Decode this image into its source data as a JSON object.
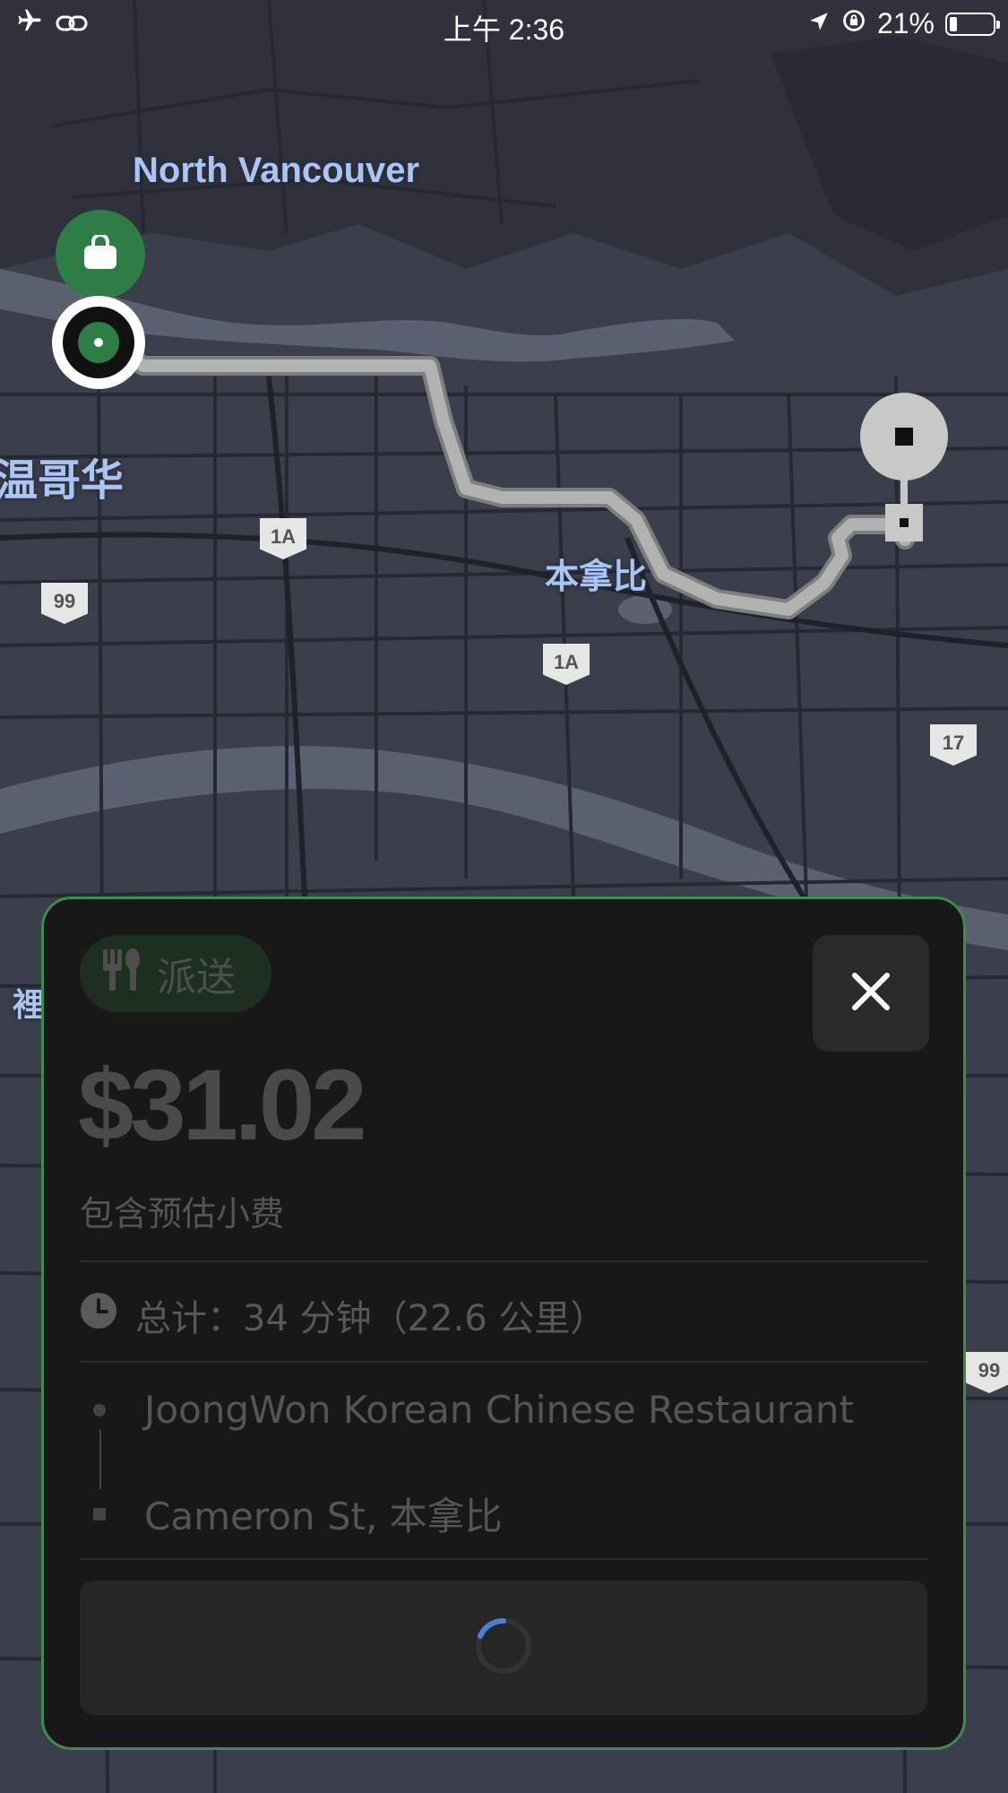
{
  "status_bar": {
    "time": "上午 2:36",
    "battery_percent": "21%",
    "battery_level": 0.21,
    "icons": [
      "airplane-icon",
      "link-icon",
      "location-arrow-icon",
      "rotation-lock-icon",
      "battery-icon"
    ]
  },
  "map": {
    "labels": {
      "north_vancouver": "North Vancouver",
      "vancouver": "温哥华",
      "burnaby": "本拿比",
      "edge_char": "裡"
    },
    "highway_shields": [
      "1A",
      "99",
      "1A",
      "17",
      "99"
    ],
    "pickup_marker_icon": "shopping-bag-icon",
    "dropoff_marker_icon": "square-stop-icon"
  },
  "offer_card": {
    "badge_label": "派送",
    "badge_icon": "utensils-icon",
    "close_icon": "close-icon",
    "price": "$31.02",
    "tip_note": "包含预估小费",
    "summary_icon": "clock-icon",
    "summary": "总计：34 分钟（22.6 公里）",
    "pickup": "JoongWon Korean Chinese Restaurant",
    "dropoff": "Cameron St, 本拿比",
    "action_state": "loading-spinner"
  },
  "colors": {
    "map_bg": "#3b3f4c",
    "card_bg": "#181818",
    "card_border": "#3f8a4f",
    "pickup_green": "#2e7d46",
    "route_gray": "#a8a8a8",
    "label_blue": "#a9c4f5",
    "spinner_blue": "#4a7fd4"
  }
}
